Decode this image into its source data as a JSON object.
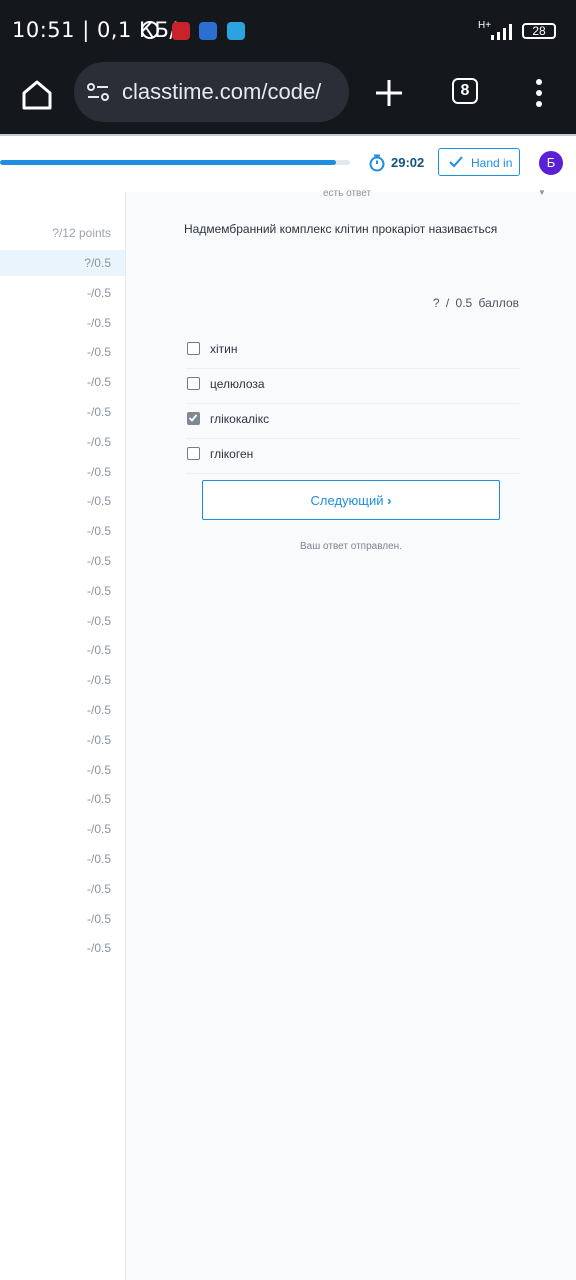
{
  "status_bar": {
    "time": "10:51 | 0,1 КБ/с",
    "network": "H+",
    "battery": "28"
  },
  "browser": {
    "url": "classtime.com/code/",
    "tab_count": "8"
  },
  "header": {
    "progress_fraction": 0.96,
    "timer": "29:02",
    "hand_in_label": "Hand in",
    "avatar_initial": "Б"
  },
  "sidebar": {
    "total_points": "?/12 points",
    "questions": [
      "?/0.5",
      "-/0.5",
      "-/0.5",
      "-/0.5",
      "-/0.5",
      "-/0.5",
      "-/0.5",
      "-/0.5",
      "-/0.5",
      "-/0.5",
      "-/0.5",
      "-/0.5",
      "-/0.5",
      "-/0.5",
      "-/0.5",
      "-/0.5",
      "-/0.5",
      "-/0.5",
      "-/0.5",
      "-/0.5",
      "-/0.5",
      "-/0.5",
      "-/0.5",
      "-/0.5"
    ],
    "active_index": 0
  },
  "question": {
    "cut_label": "есть ответ",
    "text": "Надмембранний комплекс клітин прокаріот називається",
    "score": "? / 0.5 баллов",
    "options": [
      {
        "label": "хітин",
        "checked": false
      },
      {
        "label": "целюлоза",
        "checked": false
      },
      {
        "label": "глікокалікс",
        "checked": true
      },
      {
        "label": "глікоген",
        "checked": false
      }
    ],
    "next_label": "Следующий",
    "sent_message": "Ваш ответ отправлен."
  },
  "colors": {
    "accent": "#1e8fde",
    "avatar": "#5b1fd6",
    "status_bar": "#14171c"
  }
}
